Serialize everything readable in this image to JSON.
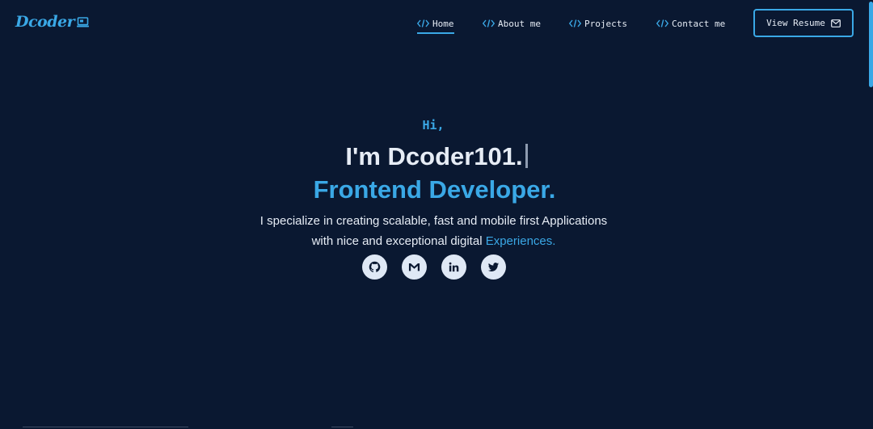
{
  "brand": {
    "logo_text": "Dcoder",
    "logo_icon": "laptop-icon",
    "accent_color": "#3aa8e6",
    "background_color": "#0a1831"
  },
  "nav": {
    "items": [
      {
        "label": "Home",
        "icon": "code-icon",
        "active": true
      },
      {
        "label": "About me",
        "icon": "code-icon",
        "active": false
      },
      {
        "label": "Projects",
        "icon": "code-icon",
        "active": false
      },
      {
        "label": "Contact me",
        "icon": "code-icon",
        "active": false
      }
    ],
    "resume_label": "View Resume",
    "resume_icon": "mail-icon"
  },
  "hero": {
    "greeting": "Hi,",
    "name": "I'm Dcoder101.",
    "role": "Frontend Developer.",
    "tagline_line1": "I specialize in creating scalable, fast and mobile first Applications",
    "tagline_line2": "with nice and exceptional digital ",
    "tagline_accent": "Experiences."
  },
  "socials": [
    {
      "name": "github",
      "icon": "github-icon"
    },
    {
      "name": "gmail",
      "icon": "gmail-icon"
    },
    {
      "name": "linkedin",
      "icon": "linkedin-icon"
    },
    {
      "name": "twitter",
      "icon": "twitter-icon"
    }
  ]
}
